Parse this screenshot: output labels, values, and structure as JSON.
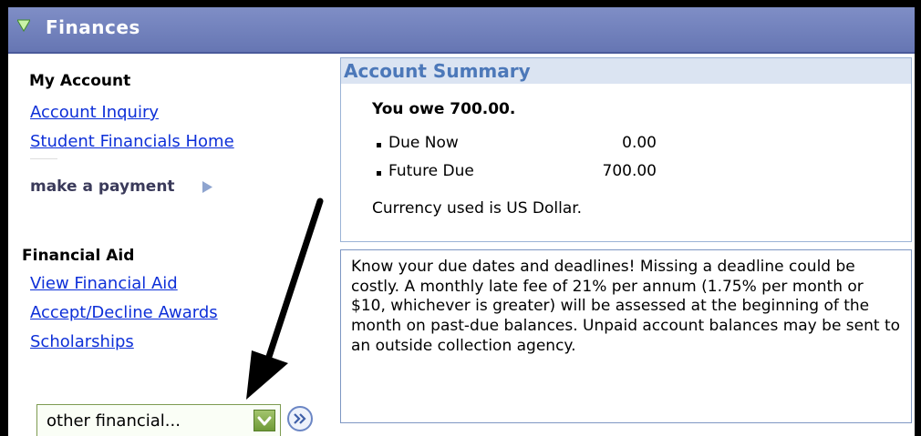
{
  "header": {
    "title": "Finances",
    "expand_icon": "triangle-down-icon"
  },
  "my_account": {
    "heading": "My Account",
    "links": [
      "Account Inquiry",
      "Student Financials Home"
    ],
    "payment_label": "make a payment",
    "payment_icon": "play-arrow-icon"
  },
  "financial_aid": {
    "heading": "Financial Aid",
    "links": [
      "View Financial Aid",
      "Accept/Decline Awards",
      "Scholarships"
    ]
  },
  "other_financial": {
    "selected": "other financial...",
    "dropdown_icon": "chevron-down-icon",
    "go_icon": "double-chevron-right-icon"
  },
  "account_summary": {
    "title": "Account Summary",
    "owed": "You owe 700.00.",
    "items": [
      {
        "label": "Due Now",
        "amount": "0.00"
      },
      {
        "label": "Future Due",
        "amount": "700.00"
      }
    ],
    "currency_note": "Currency used is US Dollar."
  },
  "notice": {
    "text": "Know your due dates and deadlines! Missing a deadline could be costly. A monthly late fee of 21% per annum (1.75% per month or $10, whichever is greater) will be assessed at the beginning of the month on past-due balances. Unpaid account balances may be sent to an outside collection agency."
  },
  "colors": {
    "header_bg": "#7381be",
    "link": "#0d2fd8",
    "summary_title": "#4c78b9",
    "summary_title_bg": "#dbe4f2",
    "dropdown_green": "#7fa84a"
  }
}
